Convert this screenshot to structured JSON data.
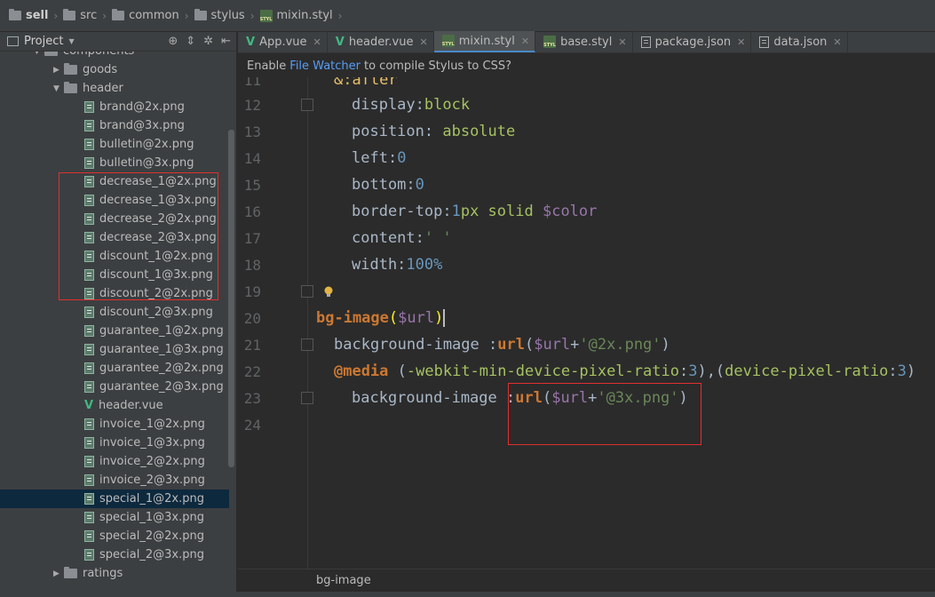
{
  "breadcrumb": [
    "sell",
    "src",
    "common",
    "stylus",
    "mixin.styl"
  ],
  "project_panel": {
    "title": "Project",
    "tree": [
      {
        "label": "components",
        "kind": "folder",
        "indent": 1,
        "open": true
      },
      {
        "label": "goods",
        "kind": "folder",
        "indent": 2,
        "open": false
      },
      {
        "label": "header",
        "kind": "folder",
        "indent": 2,
        "open": true
      },
      {
        "label": "brand@2x.png",
        "kind": "png",
        "indent": 3
      },
      {
        "label": "brand@3x.png",
        "kind": "png",
        "indent": 3
      },
      {
        "label": "bulletin@2x.png",
        "kind": "png",
        "indent": 3
      },
      {
        "label": "bulletin@3x.png",
        "kind": "png",
        "indent": 3
      },
      {
        "label": "decrease_1@2x.png",
        "kind": "png",
        "indent": 3
      },
      {
        "label": "decrease_1@3x.png",
        "kind": "png",
        "indent": 3
      },
      {
        "label": "decrease_2@2x.png",
        "kind": "png",
        "indent": 3
      },
      {
        "label": "decrease_2@3x.png",
        "kind": "png",
        "indent": 3
      },
      {
        "label": "discount_1@2x.png",
        "kind": "png",
        "indent": 3
      },
      {
        "label": "discount_1@3x.png",
        "kind": "png",
        "indent": 3
      },
      {
        "label": "discount_2@2x.png",
        "kind": "png",
        "indent": 3
      },
      {
        "label": "discount_2@3x.png",
        "kind": "png",
        "indent": 3
      },
      {
        "label": "guarantee_1@2x.png",
        "kind": "png",
        "indent": 3
      },
      {
        "label": "guarantee_1@3x.png",
        "kind": "png",
        "indent": 3
      },
      {
        "label": "guarantee_2@2x.png",
        "kind": "png",
        "indent": 3
      },
      {
        "label": "guarantee_2@3x.png",
        "kind": "png",
        "indent": 3
      },
      {
        "label": "header.vue",
        "kind": "vue",
        "indent": 3
      },
      {
        "label": "invoice_1@2x.png",
        "kind": "png",
        "indent": 3
      },
      {
        "label": "invoice_1@3x.png",
        "kind": "png",
        "indent": 3
      },
      {
        "label": "invoice_2@2x.png",
        "kind": "png",
        "indent": 3
      },
      {
        "label": "invoice_2@3x.png",
        "kind": "png",
        "indent": 3
      },
      {
        "label": "special_1@2x.png",
        "kind": "png",
        "indent": 3,
        "selected": true
      },
      {
        "label": "special_1@3x.png",
        "kind": "png",
        "indent": 3
      },
      {
        "label": "special_2@2x.png",
        "kind": "png",
        "indent": 3
      },
      {
        "label": "special_2@3x.png",
        "kind": "png",
        "indent": 3
      },
      {
        "label": "ratings",
        "kind": "folder",
        "indent": 2,
        "open": false
      }
    ]
  },
  "tabs": [
    {
      "label": "App.vue",
      "icon": "vue-icon",
      "active": false
    },
    {
      "label": "header.vue",
      "icon": "vue-icon",
      "active": false
    },
    {
      "label": "mixin.styl",
      "icon": "stylus-file-icon",
      "active": true
    },
    {
      "label": "base.styl",
      "icon": "stylus-file-icon",
      "active": false
    },
    {
      "label": "package.json",
      "icon": "json-file-icon",
      "active": false
    },
    {
      "label": "data.json",
      "icon": "json-file-icon",
      "active": false
    }
  ],
  "notification": {
    "prefix": "Enable",
    "link": "File Watcher",
    "suffix": "to compile Stylus to CSS?"
  },
  "editor": {
    "lines": [
      {
        "num": "11",
        "text": "&:after"
      },
      {
        "num": "12",
        "text": "display:block"
      },
      {
        "num": "13",
        "text": "position: absolute"
      },
      {
        "num": "14",
        "text": "left:0"
      },
      {
        "num": "15",
        "text": "bottom:0"
      },
      {
        "num": "16",
        "text": "border-top:1px solid $color"
      },
      {
        "num": "17",
        "text": "content:' '"
      },
      {
        "num": "18",
        "text": "width:100%"
      },
      {
        "num": "19",
        "text": ""
      },
      {
        "num": "20",
        "text": "bg-image($url)"
      },
      {
        "num": "21",
        "text": "background-image :url($url+'@2x.png')"
      },
      {
        "num": "22",
        "text": "@media (-webkit-min-device-pixel-ratio:3),(device-pixel-ratio:3)"
      },
      {
        "num": "23",
        "text": "background-image :url($url+'@3x.png')"
      },
      {
        "num": "24",
        "text": ""
      }
    ]
  },
  "footer": {
    "breadcrumb": "bg-image"
  },
  "colors": {
    "editor_bg": "#2b2b2b",
    "panel_bg": "#3c3f41",
    "selection": "#0d293e",
    "annotation": "#e03030",
    "keyword": "#cc7832",
    "string": "#6a8759",
    "number": "#6897bb",
    "variable": "#9876aa"
  }
}
